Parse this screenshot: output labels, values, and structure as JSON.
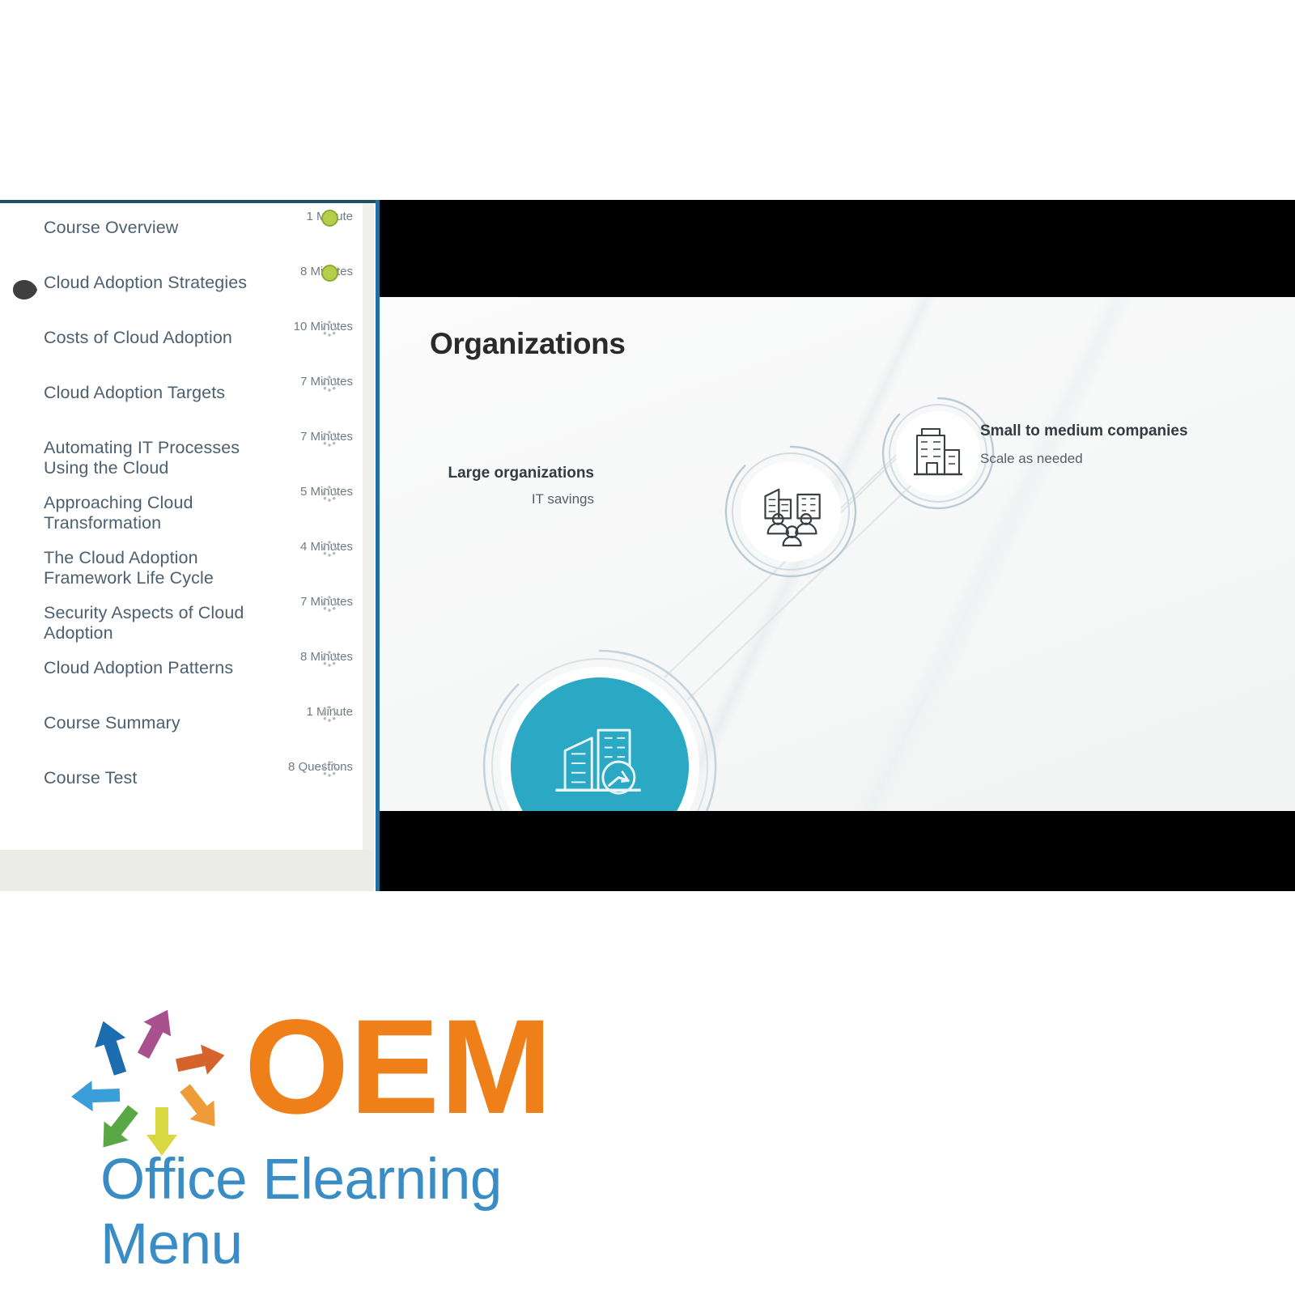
{
  "player": {
    "sidebar": {
      "scrollbar_present": true,
      "items": [
        {
          "label": "Course Overview",
          "duration": "1 Minute",
          "status": "completed",
          "active": false
        },
        {
          "label": "Cloud Adoption Strategies",
          "duration": "8 Minutes",
          "status": "completed",
          "active": true
        },
        {
          "label": "Costs of Cloud Adoption",
          "duration": "10 Minutes",
          "status": "not-started",
          "active": false
        },
        {
          "label": "Cloud Adoption Targets",
          "duration": "7 Minutes",
          "status": "not-started",
          "active": false
        },
        {
          "label": "Automating IT Processes Using the Cloud",
          "duration": "7 Minutes",
          "status": "not-started",
          "active": false
        },
        {
          "label": "Approaching Cloud Transformation",
          "duration": "5 Minutes",
          "status": "not-started",
          "active": false
        },
        {
          "label": "The Cloud Adoption Framework Life Cycle",
          "duration": "4 Minutes",
          "status": "not-started",
          "active": false
        },
        {
          "label": "Security Aspects of Cloud Adoption",
          "duration": "7 Minutes",
          "status": "not-started",
          "active": false
        },
        {
          "label": "Cloud Adoption Patterns",
          "duration": "8 Minutes",
          "status": "not-started",
          "active": false
        },
        {
          "label": "Course Summary",
          "duration": "1 Minute",
          "status": "not-started",
          "active": false
        },
        {
          "label": "Course Test",
          "duration": "8 Questions",
          "status": "not-started",
          "active": false
        }
      ]
    },
    "slide": {
      "title": "Organizations",
      "nodes": [
        {
          "title": "Large organizations",
          "subtitle": "IT savings",
          "icon": "buildings-people-icon",
          "highlighted": false
        },
        {
          "title": "Small to medium companies",
          "subtitle": "Scale as needed",
          "icon": "office-building-icon",
          "highlighted": false
        },
        {
          "title": "",
          "subtitle": "",
          "icon": "buildings-chart-icon",
          "highlighted": true
        }
      ]
    }
  },
  "logo": {
    "wordmark": "OEM",
    "tagline": "Office Elearning Menu",
    "arrow_colors": [
      "#1c6cb0",
      "#3a9ed8",
      "#5aa845",
      "#d9d843",
      "#ee9b3a",
      "#d4632c",
      "#a9508f"
    ]
  },
  "colors": {
    "accent_teal": "#2aa8c4",
    "brand_orange": "#ee7f19",
    "brand_blue": "#3a8dc4",
    "status_done": "#b6cf4b",
    "divider_blue": "#1f6fa3",
    "rule_dark": "#1f4e66"
  }
}
